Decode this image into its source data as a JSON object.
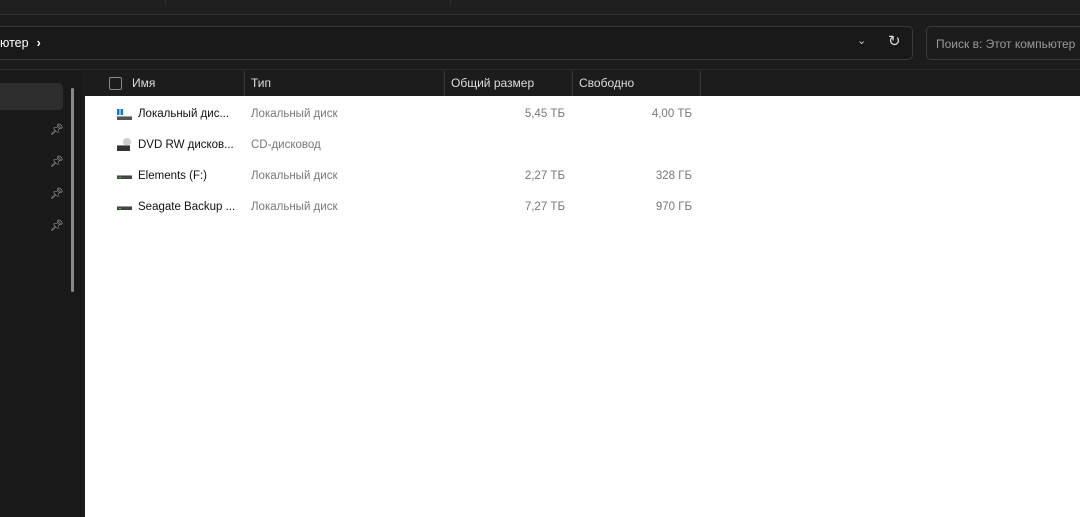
{
  "address": {
    "crumb": "ютер"
  },
  "search": {
    "placeholder": "Поиск в: Этот компьютер"
  },
  "columns": [
    "Имя",
    "Тип",
    "Общий размер",
    "Свободно"
  ],
  "rows": [
    {
      "name": "Локальный дис...",
      "type": "Локальный диск",
      "size": "5,45 ТБ",
      "free": "4,00 ТБ",
      "icon": "system-drive-icon"
    },
    {
      "name": "DVD RW дисков...",
      "type": "CD-дисковод",
      "size": "",
      "free": "",
      "icon": "dvd-drive-icon"
    },
    {
      "name": "Elements (F:)",
      "type": "Локальный диск",
      "size": "2,27 ТБ",
      "free": "328 ГБ",
      "icon": "drive-icon"
    },
    {
      "name": "Seagate Backup ...",
      "type": "Локальный диск",
      "size": "7,27 ТБ",
      "free": "970 ГБ",
      "icon": "drive-icon"
    }
  ]
}
